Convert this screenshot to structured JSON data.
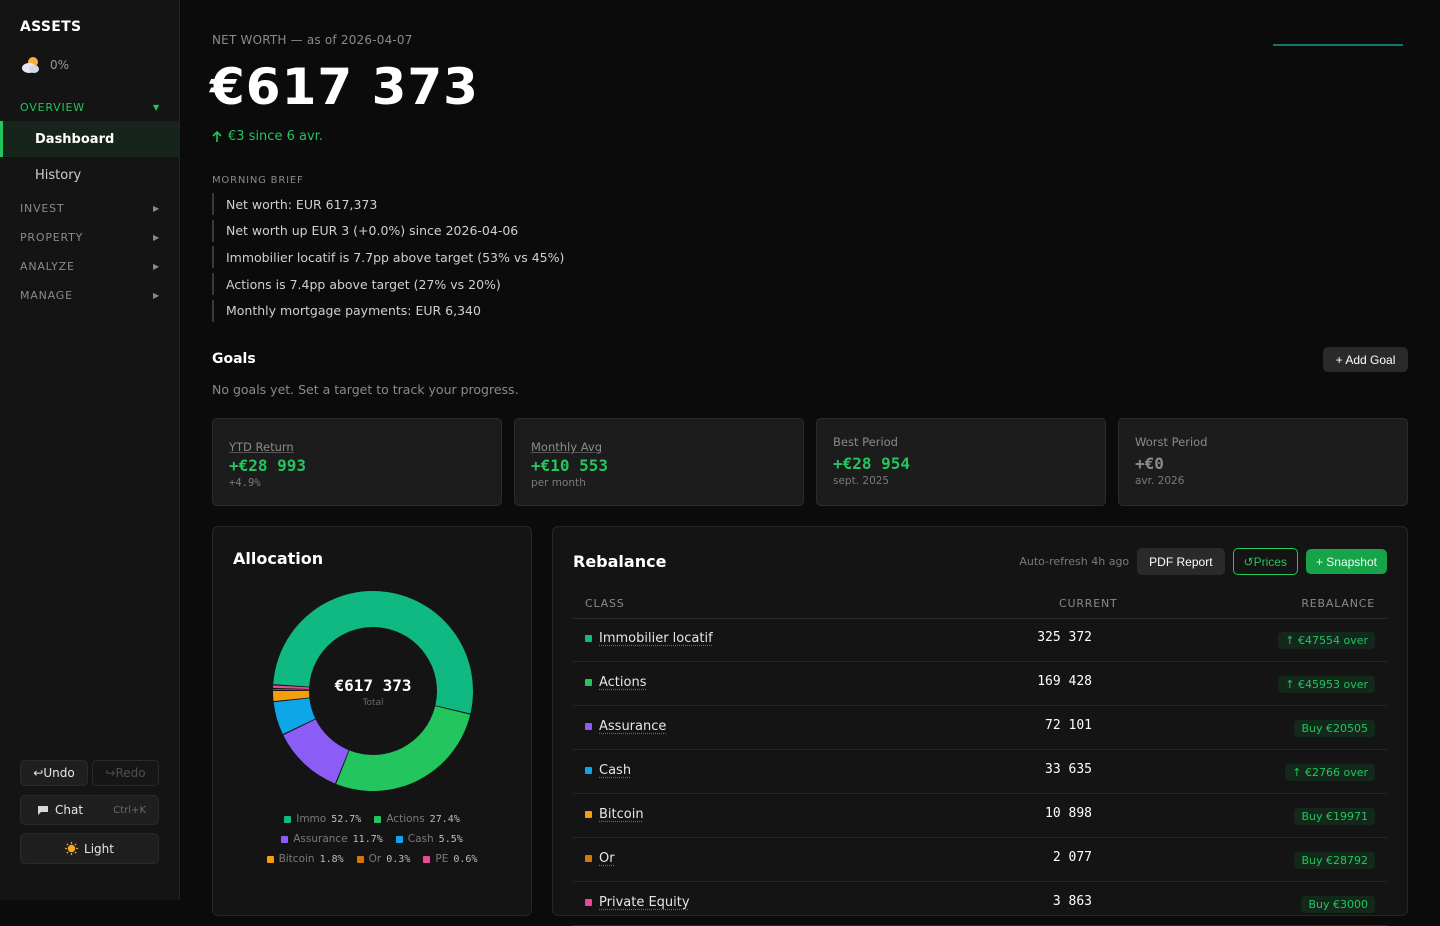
{
  "sidebar": {
    "brand": "ASSETS",
    "weather_pct": "0%",
    "sections": {
      "overview": "OVERVIEW",
      "invest": "INVEST",
      "property": "PROPERTY",
      "analyze": "ANALYZE",
      "manage": "MANAGE"
    },
    "items": {
      "dashboard": "Dashboard",
      "history": "History"
    },
    "undo": "↩Undo",
    "redo": "↪Redo",
    "chat": "Chat",
    "chat_shortcut": "Ctrl+K",
    "theme": "Light"
  },
  "header": {
    "net_worth_label": "NET WORTH — as of 2026-04-07",
    "net_worth_value": "€617 373",
    "change": "€3 since 6 avr."
  },
  "brief": {
    "label": "MORNING BRIEF",
    "items": [
      "Net worth: EUR 617,373",
      "Net worth up EUR 3 (+0.0%) since 2026-04-06",
      "Immobilier locatif is 7.7pp above target (53% vs 45%)",
      "Actions is 7.4pp above target (27% vs 20%)",
      "Monthly mortgage payments: EUR 6,340"
    ]
  },
  "goals": {
    "title": "Goals",
    "add_label": "+ Add Goal",
    "empty_text": "No goals yet. Set a target to track your progress."
  },
  "stats": [
    {
      "label": "YTD Return",
      "value": "+€28 993",
      "sub": "+4.9%"
    },
    {
      "label": "Monthly Avg",
      "value": "+€10 553",
      "sub": "per month"
    },
    {
      "label": "Best Period",
      "value": "+€28 954",
      "sub": "sept. 2025"
    },
    {
      "label": "Worst Period",
      "value": "+€0",
      "sub": "avr. 2026"
    }
  ],
  "allocation": {
    "title": "Allocation",
    "center_value": "€617 373",
    "center_label": "Total",
    "legend": [
      {
        "name": "Immo",
        "pct": "52.7%"
      },
      {
        "name": "Actions",
        "pct": "27.4%"
      },
      {
        "name": "Assurance",
        "pct": "11.7%"
      },
      {
        "name": "Cash",
        "pct": "5.5%"
      },
      {
        "name": "Bitcoin",
        "pct": "1.8%"
      },
      {
        "name": "Or",
        "pct": "0.3%"
      },
      {
        "name": "PE",
        "pct": "0.6%"
      }
    ]
  },
  "chart_data": {
    "type": "pie",
    "categories": [
      "Immo",
      "Actions",
      "Assurance",
      "Cash",
      "Bitcoin",
      "Or",
      "PE"
    ],
    "values": [
      52.7,
      27.4,
      11.7,
      5.5,
      1.8,
      0.3,
      0.6
    ],
    "colors": [
      "#10b981",
      "#22c55e",
      "#8b5cf6",
      "#0ea5e9",
      "#f59e0b",
      "#d97706",
      "#ec4899"
    ],
    "title": "Allocation"
  },
  "rebalance": {
    "title": "Rebalance",
    "auto_refresh": "Auto-refresh 4h ago",
    "pdf_label": "PDF Report",
    "prices_label": "↺Prices",
    "snapshot_label": "+ Snapshot",
    "columns": {
      "class": "CLASS",
      "current": "CURRENT",
      "rebalance": "REBALANCE"
    },
    "rows": [
      {
        "name": "Immobilier locatif",
        "current": "325 372",
        "action": "↑ €47554 over",
        "color": "#10b981"
      },
      {
        "name": "Actions",
        "current": "169 428",
        "action": "↑ €45953 over",
        "color": "#22c55e"
      },
      {
        "name": "Assurance",
        "current": "72 101",
        "action": "Buy €20505",
        "color": "#8b5cf6"
      },
      {
        "name": "Cash",
        "current": "33 635",
        "action": "↑ €2766 over",
        "color": "#0ea5e9"
      },
      {
        "name": "Bitcoin",
        "current": "10 898",
        "action": "Buy €19971",
        "color": "#f59e0b"
      },
      {
        "name": "Or",
        "current": "2 077",
        "action": "Buy €28792",
        "color": "#d97706"
      },
      {
        "name": "Private Equity",
        "current": "3 863",
        "action": "Buy €3000",
        "color": "#ec4899"
      }
    ]
  }
}
